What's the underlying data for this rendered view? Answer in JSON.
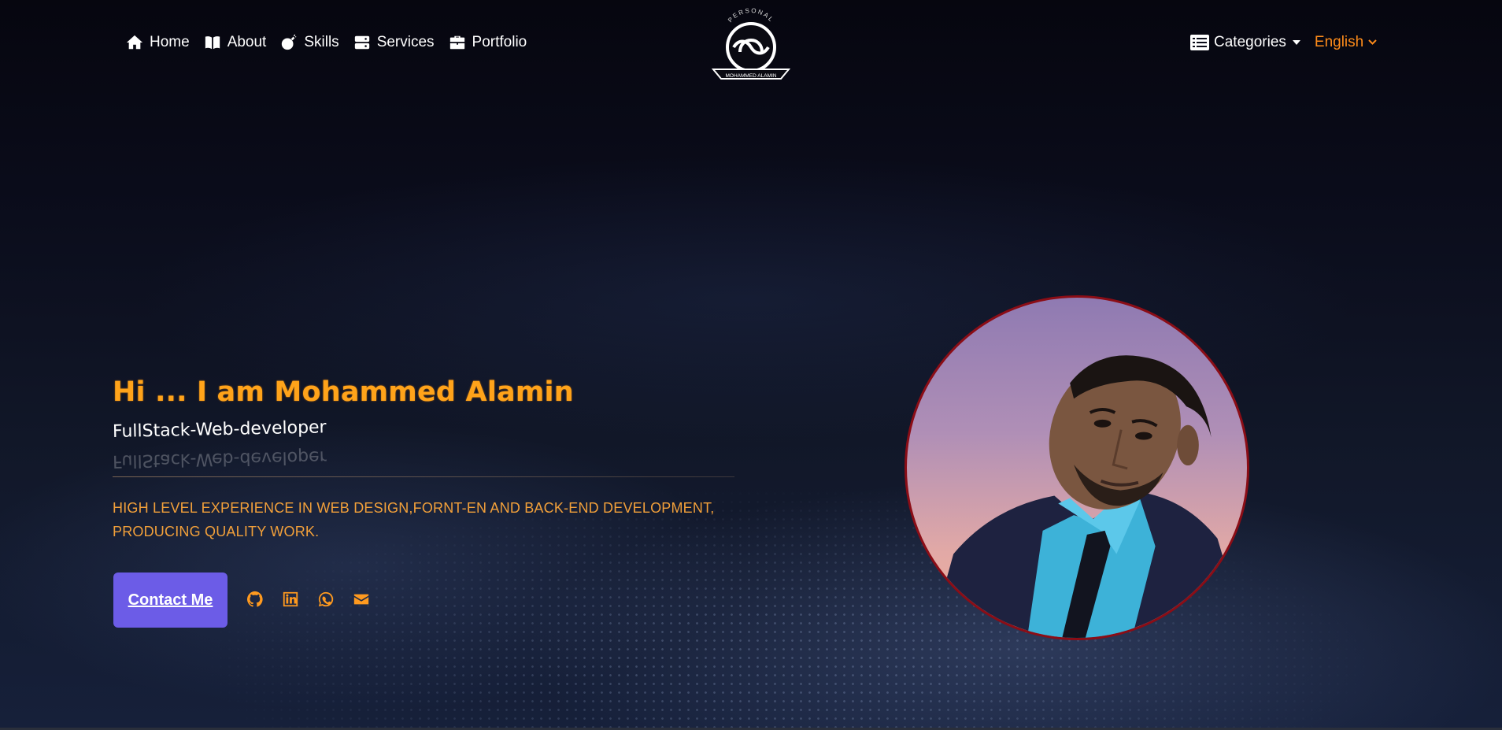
{
  "nav": {
    "items": [
      {
        "label": "Home",
        "icon": "home-icon"
      },
      {
        "label": "About",
        "icon": "book-icon"
      },
      {
        "label": "Skills",
        "icon": "bomb-icon"
      },
      {
        "label": "Services",
        "icon": "server-icon"
      },
      {
        "label": "Portfolio",
        "icon": "briefcase-icon"
      }
    ],
    "categories_label": "Categories",
    "language_label": "English"
  },
  "logo": {
    "top_text": "PERSONAL",
    "bottom_text": "MOHAMMED ALAMIN"
  },
  "hero": {
    "title": "Hi ... I am Mohammed Alamin",
    "subtitle": "FullStack-Web-developer",
    "description": "HIGH LEVEL EXPERIENCE IN WEB DESIGN,FORNT-EN AND BACK-END DEVELOPMENT, PRODUCING QUALITY WORK.",
    "contact_label": "Contact Me"
  },
  "socials": [
    "github-icon",
    "linkedin-icon",
    "whatsapp-icon",
    "envelope-icon"
  ],
  "colors": {
    "accent": "#ffa31a",
    "button": "#6c5ce7",
    "photo_border": "#8b0d16"
  }
}
